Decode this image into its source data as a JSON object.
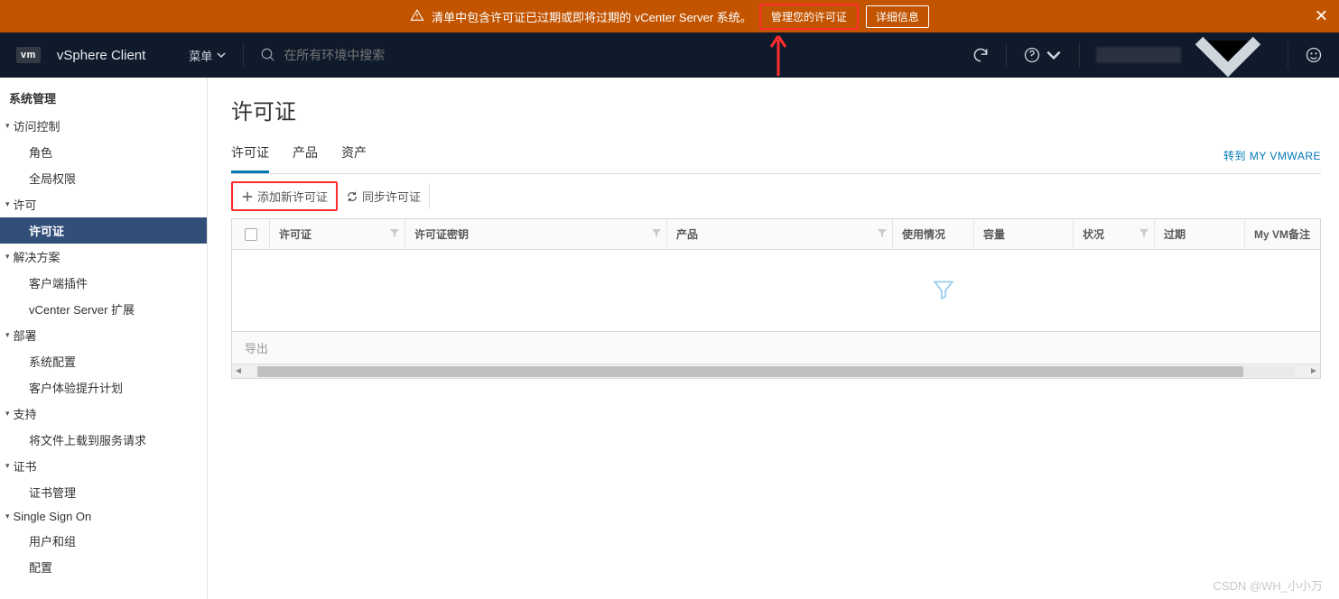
{
  "warning": {
    "text": "清单中包含许可证已过期或即将过期的 vCenter Server 系统。",
    "manage_btn": "管理您的许可证",
    "details_btn": "详细信息"
  },
  "header": {
    "logo": "vm",
    "brand": "vSphere Client",
    "menu_label": "菜单",
    "search_placeholder": "在所有环境中搜索"
  },
  "sidebar": {
    "heading": "系统管理",
    "groups": [
      {
        "label": "访问控制",
        "items": [
          "角色",
          "全局权限"
        ]
      },
      {
        "label": "许可",
        "items": [
          "许可证"
        ],
        "active_item": "许可证"
      },
      {
        "label": "解决方案",
        "items": [
          "客户端插件",
          "vCenter Server 扩展"
        ]
      },
      {
        "label": "部署",
        "items": [
          "系统配置",
          "客户体验提升计划"
        ]
      },
      {
        "label": "支持",
        "items": [
          "将文件上载到服务请求"
        ]
      },
      {
        "label": "证书",
        "items": [
          "证书管理"
        ]
      },
      {
        "label": "Single Sign On",
        "items": [
          "用户和组",
          "配置"
        ]
      }
    ]
  },
  "main": {
    "title": "许可证",
    "tabs": [
      "许可证",
      "产品",
      "资产"
    ],
    "active_tab": "许可证",
    "goto_vmware": "转到 MY VMWARE",
    "toolbar": {
      "add": "添加新许可证",
      "sync": "同步许可证"
    },
    "columns": {
      "license": "许可证",
      "key": "许可证密钥",
      "product": "产品",
      "usage": "使用情况",
      "capacity": "容量",
      "status": "状况",
      "expire": "过期",
      "note": "My VM备注"
    },
    "export": "导出"
  },
  "watermark": "CSDN @WH_小小万"
}
